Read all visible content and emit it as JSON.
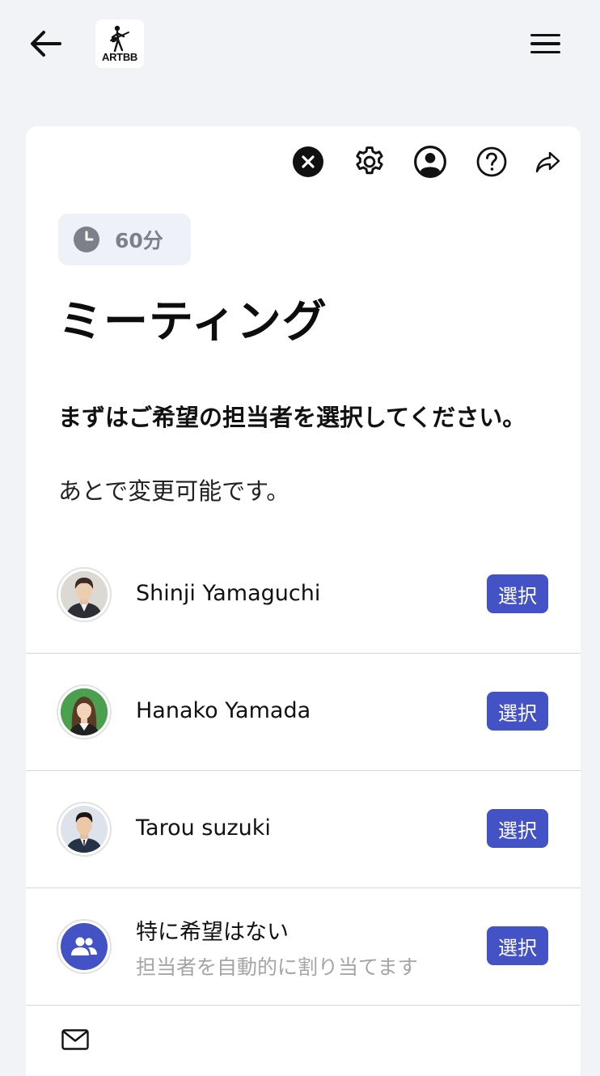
{
  "header": {
    "logo_text": "ARTBB"
  },
  "toolbar": {
    "icons": [
      "close-icon",
      "gear-icon",
      "user-icon",
      "help-icon",
      "share-icon"
    ]
  },
  "event": {
    "duration": "60分",
    "title": "ミーティング",
    "instruction": "まずはご希望の担当者を選択してください。",
    "instruction_sub": "あとで変更可能です。"
  },
  "staff": [
    {
      "name": "Shinji Yamaguchi",
      "select_label": "選択"
    },
    {
      "name": "Hanako Yamada",
      "select_label": "選択"
    },
    {
      "name": "Tarou suzuki",
      "select_label": "選択"
    },
    {
      "name": "特に希望はない",
      "sub": "担当者を自動的に割り当てます",
      "select_label": "選択"
    }
  ],
  "colors": {
    "accent": "#4352c4",
    "background": "#f2f3f7",
    "duration_chip": "#eef2f8",
    "muted_text": "#a5a5a5"
  }
}
